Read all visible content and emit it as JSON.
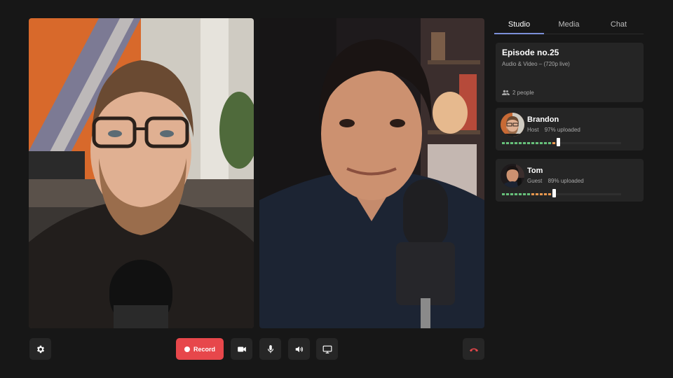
{
  "tabs": [
    {
      "label": "Studio",
      "active": true
    },
    {
      "label": "Media",
      "active": false
    },
    {
      "label": "Chat",
      "active": false
    }
  ],
  "episode": {
    "title": "Episode no.25",
    "subtitle": "Audio & Video – (720p live)",
    "people_count": "2 people"
  },
  "participants": [
    {
      "name": "Brandon",
      "role": "Host",
      "upload": "97% uploaded",
      "progress": 0.97
    },
    {
      "name": "Tom",
      "role": "Guest",
      "upload": "89% uploaded",
      "progress": 0.89
    }
  ],
  "controls": {
    "settings_icon": "gear-icon",
    "record_label": "Record",
    "camera_icon": "video-camera-icon",
    "mic_icon": "microphone-icon",
    "speaker_icon": "speaker-icon",
    "screen_icon": "monitor-icon",
    "hangup_icon": "phone-hangup-icon"
  },
  "colors": {
    "background": "#171717",
    "record": "#e7474b",
    "hangup_icon": "#e7474b",
    "progress_green": "#66c07a",
    "progress_orange": "#e8974d",
    "active_tab_underline": "#7b8fd8"
  }
}
